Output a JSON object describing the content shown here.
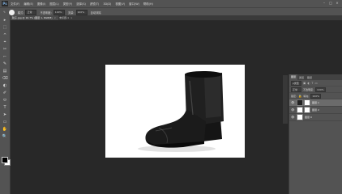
{
  "app": {
    "logo": "Ps"
  },
  "menu": [
    "文件(F)",
    "编辑(E)",
    "图像(I)",
    "图层(L)",
    "类型(Y)",
    "选择(S)",
    "滤镜(T)",
    "3D(D)",
    "视图(V)",
    "窗口(W)",
    "帮助(H)"
  ],
  "window_controls": {
    "minimize": "–",
    "maximize": "□",
    "close": "×"
  },
  "options": {
    "brush_label": "模式:",
    "mode_value": "正常",
    "opacity_label": "不透明度:",
    "opacity_value": "100%",
    "flow_label": "流量:",
    "flow_value": "100%",
    "extra_label": "自动抹除"
  },
  "tabs": [
    {
      "label": "靴子.jpg @ 16.7% (图层 1, RGB/8)",
      "close": "×"
    },
    {
      "label": "未标题-1",
      "close": "×"
    }
  ],
  "tools": [
    "▸",
    "⬚",
    "ᴖ",
    "⌖",
    "✂",
    "⌐",
    "✎",
    "▤",
    "⌫",
    "◐",
    "✐",
    "⬭",
    "T",
    "➤",
    "▭",
    "✋",
    "🔍"
  ],
  "layers_panel": {
    "tabs": [
      "图层",
      "通道",
      "路径"
    ],
    "kind_label": "ρ类型",
    "blend_mode": "正常",
    "opacity_label": "不透明度:",
    "opacity_value": "100%",
    "lock_label": "锁定:",
    "fill_label": "填充:",
    "fill_value": "100%",
    "layers": [
      {
        "name": "图层 1",
        "selected": true,
        "visible": true
      },
      {
        "name": "图层 2",
        "selected": false,
        "visible": true
      },
      {
        "name": "图层 0",
        "selected": false,
        "visible": true
      }
    ]
  },
  "colors": {
    "accent": "#1c73c4",
    "ui_bg": "#535353",
    "workspace": "#282828"
  }
}
